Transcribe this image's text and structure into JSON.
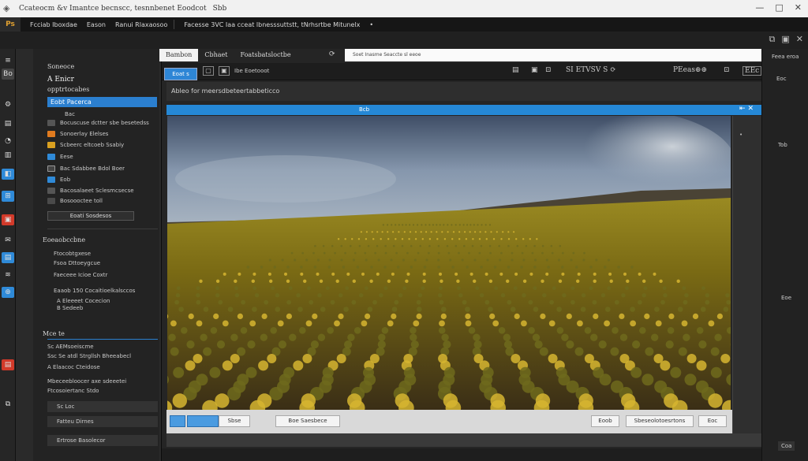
{
  "window": {
    "title": "Ccateocm &v Imantce becnscc, tesnnbenet Eoodcot",
    "title_suffix": "Sbb",
    "controls": [
      "—",
      "□",
      "✕"
    ]
  },
  "menubar": {
    "logo": "Ps",
    "items": [
      "Fcciab Iboxdae",
      "Eason",
      "Ranui Rlaxaosoo",
      "Facesse 3VC Iaa cceat lbnesssuttstt, tNrhsrtbe Mitunelx"
    ],
    "end_dot": "•"
  },
  "toolbar_right": [
    "⧉",
    "▣",
    "✕"
  ],
  "left_icons": [
    "≡",
    "Bo",
    "⚙",
    "▤",
    "◔",
    "▥",
    "◧",
    "⊞",
    "▣",
    "✉",
    "▤",
    "≋",
    "⊕",
    "▤",
    "⧉"
  ],
  "sidebar": {
    "title": "Soneoce",
    "subtitle": "A Enicr",
    "section": "opptrtocabes",
    "selected": "Eobt Pacerca",
    "item_placeholder": "Bac",
    "rows": [
      {
        "label": "Bocuscuse dctter sbe besetedss",
        "color": "#555"
      },
      {
        "label": "Sonoerlay Elelses",
        "color": "#e07b1f"
      },
      {
        "label": "Scbeerc eltcoeb Ssabiy",
        "color": "#d9a020"
      },
      {
        "label": "Eese",
        "color": "#2f8ad8"
      },
      {
        "label": "Bac Sdabbee Bdol Boer",
        "color": "#444"
      },
      {
        "label": "Eob",
        "color": "#2f8ad8"
      },
      {
        "label": "Bacosalaeet Sclesmcsecse",
        "color": "#555"
      },
      {
        "label": "Bosoooctee toll",
        "color": "#4a4a4a"
      }
    ],
    "button": "Eoati Sosdesos",
    "group2_title": "Eoeaobccbne",
    "group2_rows": [
      "Ftocobtgxese",
      "Fsoa Dttoeygcue",
      "Faeceee Icioe Coxtr"
    ],
    "group3_rows": [
      "Eaaob 150 Cocaitioelkalsccos",
      "A Eleeeet Cocecion",
      "B Sedeeb"
    ],
    "group4_title": "Mce te",
    "group4_rows": [
      "Sc AEMsoeiscme",
      "Ssc Se atdl Strgllsh Bheeabecl",
      "A Elaacoc Cteidose",
      "Mbeceebloocer axe sdeeetei",
      "Ftcosoiertanc Stdo"
    ],
    "bottom1": "Sc Loc",
    "bottom2": "Fatteu Dirnes",
    "bottom3": "Ertrose Basolecor"
  },
  "main": {
    "tabs": [
      {
        "label": "Bambon",
        "active": true
      },
      {
        "label": "Cbhaet",
        "active": false
      },
      {
        "label": "Foatsbatsloctbe",
        "active": false
      }
    ],
    "url_icon": "⟳",
    "url": "Soet Inasme Seaccte sl eeoe",
    "blue_button": "Eoat s",
    "icon_labels": [
      "Ibe Eoetooot"
    ],
    "right_items": [
      "▤",
      "▣",
      "⊡",
      "SI ETVSV S ⟳",
      "PEeas⊕⊕",
      "⊡",
      "EEc"
    ],
    "path": "Ableo for meersdbeteertabbeticco",
    "chip": "Bcb",
    "strip_end": "⇤ ✕",
    "bottom_buttons": [
      "Sbse",
      "Boe Saesbece",
      "Eoob",
      "Sbeseolotoesrtons",
      "Eoc"
    ]
  },
  "rightpanel": {
    "items": [
      "Feea eroa",
      "Eoc",
      "Tob",
      "Eoe"
    ],
    "bottom": "Coa"
  },
  "photo": {
    "sky_top": "#4d5e78",
    "sky_mid": "#9aaabc",
    "hill": "#4a4335",
    "field": "#8a7d1a",
    "flower": "#d6b530",
    "soil": "#3a2a1e"
  }
}
